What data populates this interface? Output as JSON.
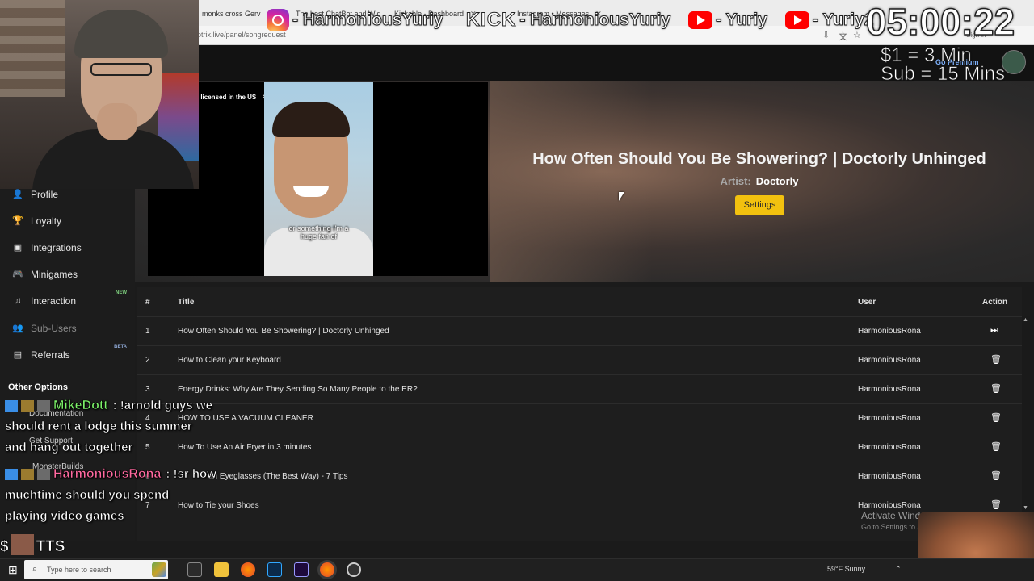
{
  "browser": {
    "tabs": [
      {
        "label": "monks cross Gerv"
      },
      {
        "label": "The best ChatBot and Wid"
      },
      {
        "label": "Kickable - Dashboard"
      },
      {
        "label": "Instagram • Messages"
      }
    ],
    "url": "otrix.live/panel/songrequest",
    "sign_in": "Sign in"
  },
  "overlay": {
    "socials": [
      {
        "platform": "instagram",
        "text": "- HarmoniousYuriy"
      },
      {
        "platform": "kick",
        "logo": "KICK",
        "text": "- HarmoniousYuriy"
      },
      {
        "platform": "youtube",
        "text": "- Yuriy"
      },
      {
        "platform": "youtube",
        "text": "- Yuriy2"
      }
    ],
    "timer": "05:00:22",
    "rate_dollar": "$1 = 3 Min",
    "rate_sub": "Sub = 15 Mins",
    "go_premium": "Go Premium",
    "chat": [
      {
        "name": "MikeDott",
        "name_color": "#7df26a",
        "lines": [
          ": !arnold guys we",
          "should rent a lodge this summer",
          "and hang out together"
        ]
      },
      {
        "name": "HarmoniousRona",
        "name_color": "#ff6aa0",
        "lines": [
          ": !sr how",
          "muchtime should you spend",
          "playing video games"
        ]
      }
    ],
    "tts_label": "TTS",
    "tts_prefix": "$"
  },
  "player": {
    "video_notice": "r licensed in the US",
    "video_caption_1": "or something I'm a",
    "video_caption_2": "huge fan of",
    "song_title": "How Often Should You Be Showering? | Doctorly Unhinged",
    "artist_label": "Artist:",
    "artist": "Doctorly",
    "settings_label": "Settings"
  },
  "sidebar": {
    "items": [
      {
        "label": "Profile",
        "icon": "user-icon",
        "glyph": "👤"
      },
      {
        "label": "Loyalty",
        "icon": "trophy-icon",
        "glyph": "🏆"
      },
      {
        "label": "Integrations",
        "icon": "puzzle-icon",
        "glyph": "▣"
      },
      {
        "label": "Minigames",
        "icon": "gamepad-icon",
        "glyph": "🎮"
      },
      {
        "label": "Interaction",
        "icon": "music-icon",
        "glyph": "♫",
        "badge": "NEW"
      },
      {
        "label": "Sub-Users",
        "icon": "users-icon",
        "glyph": "👥",
        "dim": true
      },
      {
        "label": "Referrals",
        "icon": "id-card-icon",
        "glyph": "▤",
        "badge": "BETA"
      }
    ],
    "other_options": "Other Options",
    "sub_items": [
      {
        "label": "Documentation"
      },
      {
        "label": "Get Support"
      },
      {
        "label": "MonsterBuilds"
      }
    ]
  },
  "queue": {
    "columns": {
      "num": "#",
      "title": "Title",
      "user": "User",
      "action": "Action"
    },
    "rows": [
      {
        "num": "1",
        "title": "How Often Should You Be Showering? | Doctorly Unhinged",
        "user": "HarmoniousRona",
        "action": "skip"
      },
      {
        "num": "2",
        "title": "How to Clean your Keyboard",
        "user": "HarmoniousRona",
        "action": "delete"
      },
      {
        "num": "3",
        "title": "Energy Drinks: Why Are They Sending So Many People to the ER?",
        "user": "HarmoniousRona",
        "action": "delete"
      },
      {
        "num": "4",
        "title": "HOW TO USE A VACUUM CLEANER",
        "user": "HarmoniousRona",
        "action": "delete"
      },
      {
        "num": "5",
        "title": "How To Use An Air Fryer in 3 minutes",
        "user": "HarmoniousRona",
        "action": "delete"
      },
      {
        "num": "6",
        "title": "an Eyeglasses (The Best Way) - 7 Tips",
        "user": "HarmoniousRona",
        "action": "delete"
      },
      {
        "num": "7",
        "title": "How to Tie your Shoes",
        "user": "HarmoniousRona",
        "action": "delete"
      }
    ]
  },
  "windows": {
    "activate_title": "Activate Windows",
    "activate_sub": "Go to Settings to activ",
    "search_placeholder": "Type here to search",
    "weather": "59°F  Sunny"
  },
  "colors": {
    "accent": "#f2c10f",
    "bg": "#1b1b1b"
  }
}
